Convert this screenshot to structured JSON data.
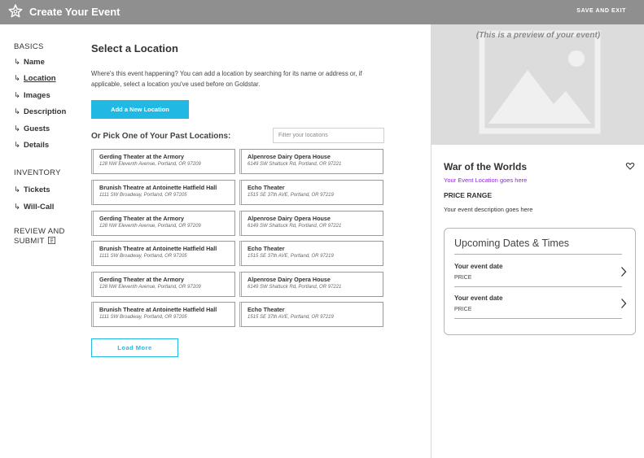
{
  "header": {
    "title": "Create Your Event",
    "save_exit": "SAVE AND EXIT"
  },
  "sidebar": {
    "basics_label": "BASICS",
    "basics_items": [
      {
        "label": "Name"
      },
      {
        "label": "Location"
      },
      {
        "label": "Images"
      },
      {
        "label": "Description"
      },
      {
        "label": "Guests"
      },
      {
        "label": "Details"
      }
    ],
    "inventory_label": "INVENTORY",
    "inventory_items": [
      {
        "label": "Tickets"
      },
      {
        "label": "Will-Call"
      }
    ],
    "review_line1": "REVIEW AND",
    "review_line2": "SUBMIT",
    "arrow_glyph": "↳",
    "active_item": "Location"
  },
  "main": {
    "heading": "Select a Location",
    "description": "Where's this event happening? You can add a location by searching for its name or address or, if applicable, select a location you've used before on Goldstar.",
    "add_button": "Add a New Location",
    "past_title": "Or Pick One of Your Past Locations:",
    "filter_placeholder": "Filter your locations",
    "load_more": "Load More",
    "locations": [
      {
        "name": "Gerding Theater at the Armory",
        "address": "128 NW Eleventh Avenue, Portland, OR 97209"
      },
      {
        "name": "Alpenrose Dairy Opera House",
        "address": "6149 SW Shattuck Rd, Portland, OR 97221"
      },
      {
        "name": "Brunish Theatre at Antoinette Hatfield Hall",
        "address": "1111 SW Broadway, Portland, OR 97205"
      },
      {
        "name": "Echo Theater",
        "address": "1515 SE 37th AVE, Portland, OR 97219"
      },
      {
        "name": "Gerding Theater at the Armory",
        "address": "128 NW Eleventh Avenue, Portland, OR 97209"
      },
      {
        "name": "Alpenrose Dairy Opera House",
        "address": "6149 SW Shattuck Rd, Portland, OR 97221"
      },
      {
        "name": "Brunish Theatre at Antoinette Hatfield Hall",
        "address": "1111 SW Broadway, Portland, OR 97205"
      },
      {
        "name": "Echo Theater",
        "address": "1515 SE 37th AVE, Portland, OR 97219"
      },
      {
        "name": "Gerding Theater at the Armory",
        "address": "128 NW Eleventh Avenue, Portland, OR 97209"
      },
      {
        "name": "Alpenrose Dairy Opera House",
        "address": "6149 SW Shattuck Rd, Portland, OR 97221"
      },
      {
        "name": "Brunish Theatre at Antoinette Hatfield Hall",
        "address": "1111 SW Broadway, Portland, OR 97205"
      },
      {
        "name": "Echo Theater",
        "address": "1515 SE 37th AVE, Portland, OR 97219"
      }
    ]
  },
  "preview": {
    "note": "(This is a preview of your event)",
    "event_title": "War of the Worlds",
    "event_location": "Your Event Location goes here",
    "price_range": "PRICE RANGE",
    "description": "Your event description goes here",
    "dates_title": "Upcoming Dates & Times",
    "dates": [
      {
        "date": "Your event date",
        "price": "PRICE"
      },
      {
        "date": "Your event date",
        "price": "PRICE"
      }
    ]
  },
  "colors": {
    "header_bg": "#8f8f8f",
    "accent": "#21b9e3",
    "location_link": "#8e2bd6",
    "image_placeholder": "#dcdcdc"
  },
  "icons": {
    "logo": "star-outline-icon",
    "heart": "heart-icon",
    "chevron": "chevron-right-icon",
    "image": "image-placeholder-icon",
    "review": "checklist-icon"
  }
}
